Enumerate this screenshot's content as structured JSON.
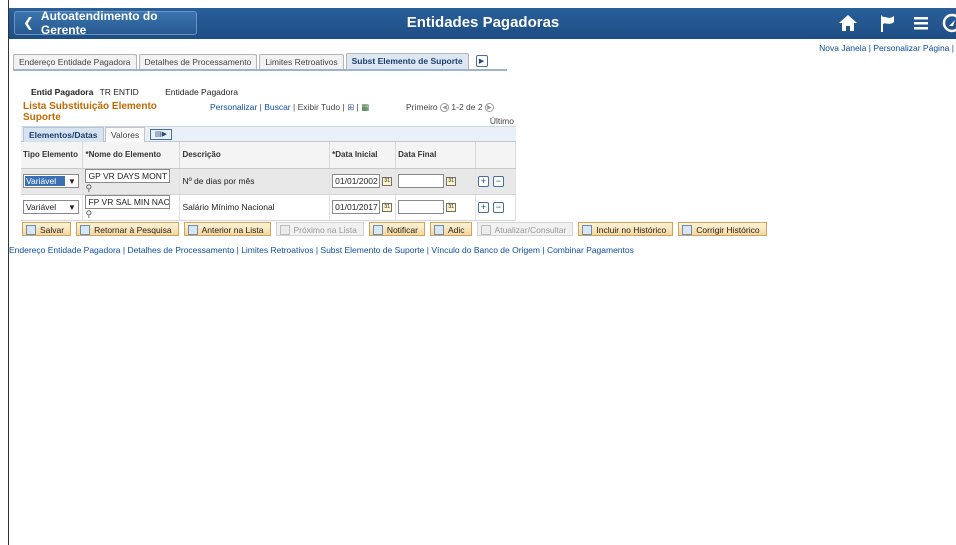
{
  "banner": {
    "back_label": "Autoatendimento do Gerente",
    "title": "Entidades Pagadoras",
    "icons": [
      "home-icon",
      "flag-icon",
      "menu-icon",
      "navbar-icon"
    ]
  },
  "top_links": [
    "Nova Janela",
    "Personalizar Página"
  ],
  "tabs": [
    {
      "label": "Endereço Entidade Pagadora"
    },
    {
      "label": "Detalhes de Processamento"
    },
    {
      "label": "Limites Retroativos"
    },
    {
      "label": "Subst Elemento de Suporte",
      "active": true
    }
  ],
  "header": {
    "label": "Entid Pagadora",
    "code": "TR ENTID",
    "description": "Entidade Pagadora"
  },
  "grid": {
    "title": "Lista Substituição Elemento Suporte",
    "links": [
      "Personalizar",
      "Buscar"
    ],
    "view_all": "Exibir Tudo",
    "nav_first": "Primeiro",
    "nav_range": "1-2 de 2",
    "nav_last": "Último",
    "subtabs": [
      "Elementos/Datas",
      "Valores"
    ],
    "columns": [
      "Tipo Elemento",
      "*Nome do Elemento",
      "Descrição",
      "*Data Inicial",
      "Data Final"
    ],
    "rows": [
      {
        "tipo": "Variável",
        "nome": "GP VR DAYS MONT",
        "descricao": "Nº de dias por mês",
        "data_inicial": "01/01/2002",
        "data_final": ""
      },
      {
        "tipo": "Variável",
        "nome": "FP VR SAL MIN NAC",
        "descricao": "Salário Mínimo Nacional",
        "data_inicial": "01/01/2017",
        "data_final": ""
      }
    ]
  },
  "toolbar": {
    "save": "Salvar",
    "return_search": "Retornar à Pesquisa",
    "prev_list": "Anterior na Lista",
    "next_list": "Próximo na Lista",
    "notify": "Notificar",
    "add": "Adic",
    "update_view": "Atualizar/Consultar",
    "include_history": "Incluir no Histórico",
    "correct_history": "Corrigir Histórico"
  },
  "bottom_links": [
    "Endereço Entidade Pagadora",
    "Detalhes de Processamento",
    "Limites Retroativos",
    "Subst Elemento de Suporte",
    "Vínculo do Banco de Origem",
    "Combinar Pagamentos"
  ]
}
